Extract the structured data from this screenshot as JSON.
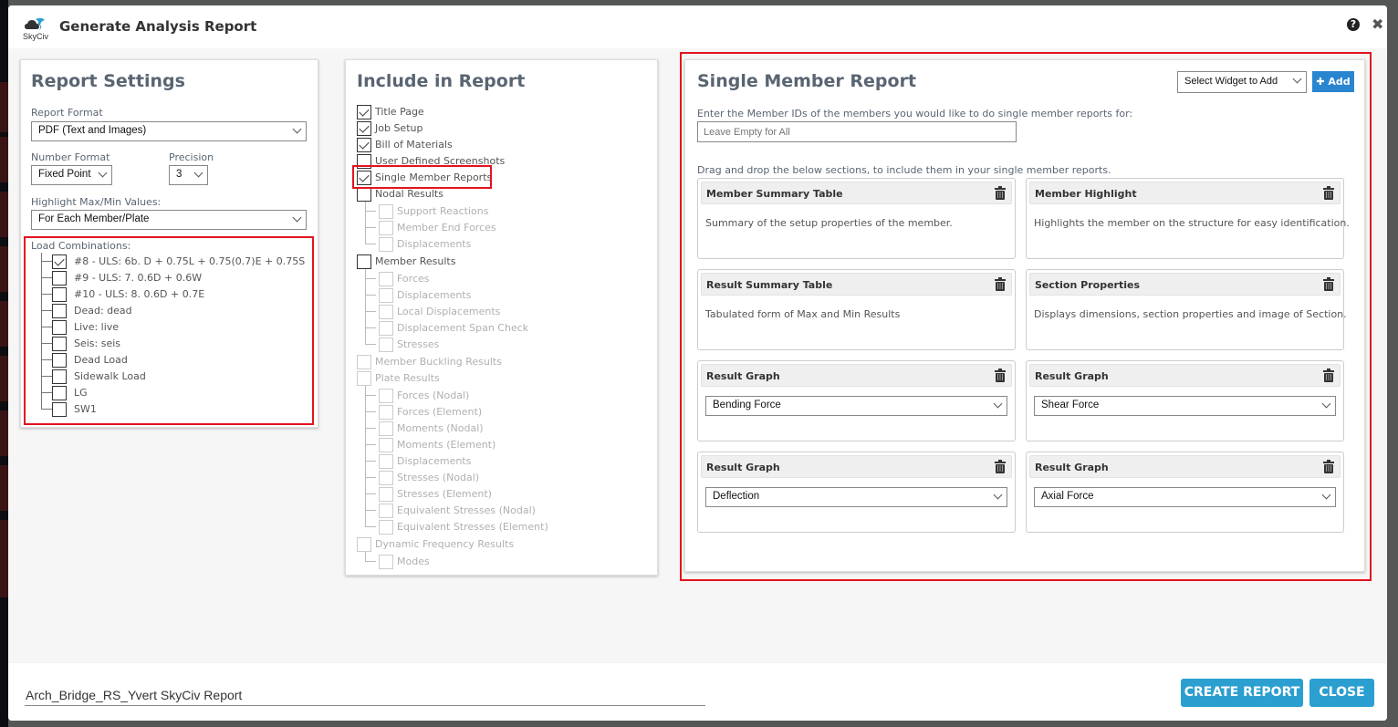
{
  "modal": {
    "title": "Generate Analysis Report",
    "brand": "SkyCiv",
    "help_glyph": "?",
    "close_glyph": "✖"
  },
  "report_settings": {
    "title": "Report Settings",
    "report_format": {
      "label": "Report Format",
      "value": "PDF (Text and Images)"
    },
    "number_format": {
      "label": "Number Format",
      "value": "Fixed Point"
    },
    "precision": {
      "label": "Precision",
      "value": "3"
    },
    "highlight": {
      "label": "Highlight Max/Min Values:",
      "value": "For Each Member/Plate"
    },
    "load_combinations": {
      "label": "Load Combinations:",
      "items": [
        {
          "label": "#8 - ULS: 6b. D + 0.75L + 0.75(0.7)E + 0.75S",
          "checked": true
        },
        {
          "label": "#9 - ULS: 7. 0.6D + 0.6W",
          "checked": false
        },
        {
          "label": "#10 - ULS: 8. 0.6D + 0.7E",
          "checked": false
        },
        {
          "label": "Dead: dead",
          "checked": false
        },
        {
          "label": "Live: live",
          "checked": false
        },
        {
          "label": "Seis: seis",
          "checked": false
        },
        {
          "label": "Dead Load",
          "checked": false
        },
        {
          "label": "Sidewalk Load",
          "checked": false
        },
        {
          "label": "LG",
          "checked": false
        },
        {
          "label": "SW1",
          "checked": false
        }
      ]
    }
  },
  "include": {
    "title": "Include in Report",
    "items": [
      {
        "label": "Title Page",
        "checked": true,
        "level": 0,
        "disabled": false
      },
      {
        "label": "Job Setup",
        "checked": true,
        "level": 0,
        "disabled": false
      },
      {
        "label": "Bill of Materials",
        "checked": true,
        "level": 0,
        "disabled": false
      },
      {
        "label": "User Defined Screenshots",
        "checked": false,
        "level": 0,
        "disabled": false
      },
      {
        "label": "Single Member Reports",
        "checked": true,
        "level": 0,
        "disabled": false
      },
      {
        "label": "Nodal Results",
        "checked": false,
        "level": 0,
        "disabled": false
      },
      {
        "label": "Support Reactions",
        "checked": false,
        "level": 1,
        "disabled": true
      },
      {
        "label": "Member End Forces",
        "checked": false,
        "level": 1,
        "disabled": true
      },
      {
        "label": "Displacements",
        "checked": false,
        "level": 1,
        "disabled": true,
        "last": true
      },
      {
        "label": "Member Results",
        "checked": false,
        "level": 0,
        "disabled": false
      },
      {
        "label": "Forces",
        "checked": false,
        "level": 1,
        "disabled": true
      },
      {
        "label": "Displacements",
        "checked": false,
        "level": 1,
        "disabled": true
      },
      {
        "label": "Local Displacements",
        "checked": false,
        "level": 1,
        "disabled": true
      },
      {
        "label": "Displacement Span Check",
        "checked": false,
        "level": 1,
        "disabled": true
      },
      {
        "label": "Stresses",
        "checked": false,
        "level": 1,
        "disabled": true,
        "last": true
      },
      {
        "label": "Member Buckling Results",
        "checked": false,
        "level": 0,
        "disabled": true
      },
      {
        "label": "Plate Results",
        "checked": false,
        "level": 0,
        "disabled": true
      },
      {
        "label": "Forces (Nodal)",
        "checked": false,
        "level": 1,
        "disabled": true
      },
      {
        "label": "Forces (Element)",
        "checked": false,
        "level": 1,
        "disabled": true
      },
      {
        "label": "Moments (Nodal)",
        "checked": false,
        "level": 1,
        "disabled": true
      },
      {
        "label": "Moments (Element)",
        "checked": false,
        "level": 1,
        "disabled": true
      },
      {
        "label": "Displacements",
        "checked": false,
        "level": 1,
        "disabled": true
      },
      {
        "label": "Stresses (Nodal)",
        "checked": false,
        "level": 1,
        "disabled": true
      },
      {
        "label": "Stresses (Element)",
        "checked": false,
        "level": 1,
        "disabled": true
      },
      {
        "label": "Equivalent Stresses (Nodal)",
        "checked": false,
        "level": 1,
        "disabled": true
      },
      {
        "label": "Equivalent Stresses (Element)",
        "checked": false,
        "level": 1,
        "disabled": true,
        "last": true
      },
      {
        "label": "Dynamic Frequency Results",
        "checked": false,
        "level": 0,
        "disabled": true
      },
      {
        "label": "Modes",
        "checked": false,
        "level": 1,
        "disabled": true,
        "last": true
      }
    ]
  },
  "single_member": {
    "title": "Single Member Report",
    "widget_select": "Select Widget to Add",
    "add_label": "Add",
    "ids_label": "Enter the Member IDs of the members you would like to do single member reports for:",
    "ids_placeholder": "Leave Empty for All",
    "drag_label": "Drag and drop the below sections, to include them in your single member reports.",
    "widgets": [
      {
        "title": "Member Summary Table",
        "desc": "Summary of the setup properties of the member."
      },
      {
        "title": "Member Highlight",
        "desc": "Highlights the member on the structure for easy identification."
      },
      {
        "title": "Result Summary Table",
        "desc": "Tabulated form of Max and Min Results"
      },
      {
        "title": "Section Properties",
        "desc": "Displays dimensions, section properties and image of Section."
      },
      {
        "title": "Result Graph",
        "select": "Bending Force"
      },
      {
        "title": "Result Graph",
        "select": "Shear Force"
      },
      {
        "title": "Result Graph",
        "select": "Deflection"
      },
      {
        "title": "Result Graph",
        "select": "Axial Force"
      }
    ]
  },
  "footer": {
    "report_name": "Arch_Bridge_RS_Yvert SkyCiv Report",
    "create_label": "CREATE REPORT",
    "close_label": "CLOSE"
  },
  "colors": {
    "accent": "#2a9fd0",
    "highlight_box": "#e3141f"
  }
}
